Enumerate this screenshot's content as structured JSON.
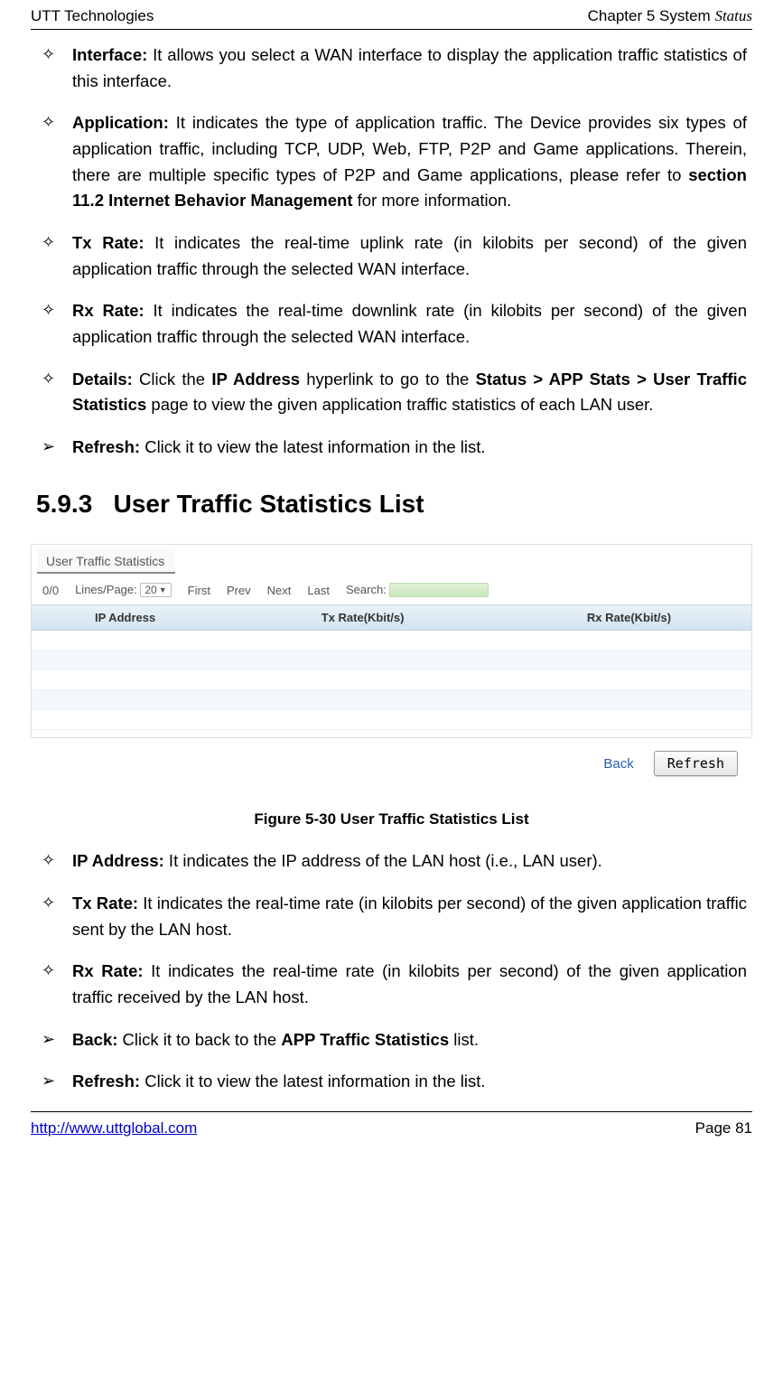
{
  "header": {
    "left": "UTT Technologies",
    "right_prefix": "Chapter 5 System ",
    "right_em": "Status"
  },
  "top_items": [
    {
      "marker": "✧",
      "label": "Interface:",
      "text": " It allows you select a WAN interface to display the application traffic statistics of this interface."
    },
    {
      "marker": "✧",
      "label": "Application:",
      "text_a": " It indicates the type of application traffic. The Device provides six types of application traffic, including TCP, UDP, Web, FTP, P2P and Game applications. Therein, there are multiple specific types of P2P and Game applications, please refer to ",
      "bold_mid": "section 11.2 Internet Behavior Management",
      "text_b": " for more information."
    },
    {
      "marker": "✧",
      "label": "Tx Rate:",
      "text": " It indicates the real-time uplink rate (in kilobits per second) of the given application traffic through the selected WAN interface."
    },
    {
      "marker": "✧",
      "label": "Rx Rate:",
      "text": " It indicates the real-time downlink rate (in kilobits per second) of the given application traffic through the selected WAN interface."
    },
    {
      "marker": "✧",
      "label": "Details:",
      "text_a": " Click the ",
      "bold_a": "IP Address",
      "text_b": " hyperlink to go to the ",
      "bold_b": "Status > APP Stats > User Traffic Statistics",
      "text_c": " page to view the given application traffic statistics of each LAN user."
    },
    {
      "marker": "➢",
      "label": "Refresh:",
      "text": " Click it to view the latest information in the list."
    }
  ],
  "section": {
    "number": "5.9.3",
    "title": "User Traffic Statistics List"
  },
  "figure": {
    "tab": "User Traffic Statistics",
    "counter": "0/0",
    "lines_label": "Lines/Page:",
    "lines_value": "20",
    "first": "First",
    "prev": "Prev",
    "next": "Next",
    "last": "Last",
    "search_label": "Search:",
    "col_ip": "IP Address",
    "col_tx": "Tx Rate(Kbit/s)",
    "col_rx": "Rx Rate(Kbit/s)",
    "back": "Back",
    "refresh": "Refresh",
    "caption": "Figure 5-30 User Traffic Statistics List"
  },
  "bottom_items": [
    {
      "marker": "✧",
      "label": "IP Address:",
      "text": " It indicates the IP address of the LAN host (i.e., LAN user)."
    },
    {
      "marker": "✧",
      "label": "Tx Rate:",
      "text": " It indicates the real-time rate (in kilobits per second) of the given application traffic sent by the LAN host."
    },
    {
      "marker": "✧",
      "label": "Rx Rate:",
      "text": " It indicates the real-time rate (in kilobits per second) of the given application traffic received by the LAN host."
    },
    {
      "marker": "➢",
      "label": "Back:",
      "text_a": " Click it to back to the ",
      "bold_a": "APP Traffic Statistics",
      "text_b": " list."
    },
    {
      "marker": "➢",
      "label": "Refresh:",
      "text": " Click it to view the latest information in the list."
    }
  ],
  "footer": {
    "url": "http://www.uttglobal.com",
    "page": "Page 81"
  }
}
